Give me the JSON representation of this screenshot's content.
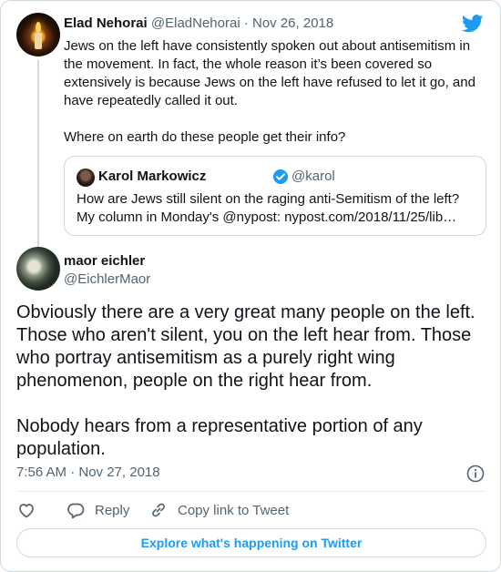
{
  "parent_tweet": {
    "author_name": "Elad Nehorai",
    "handle": "@EladNehorai",
    "separator": " · ",
    "date": "Nov 26, 2018",
    "text": "Jews on the left have consistently spoken out about antisemitism in the movement. In fact, the whole reason it’s been covered so extensively is because Jews on the left have refused to let it go, and have repeatedly called it out.\n\nWhere on earth do these people get their info?",
    "quoted": {
      "author_name": "Karol Markowicz",
      "handle": "@karol",
      "line1": "How are Jews still silent on the raging anti-Semitism of the left?",
      "line2": "My column in Monday's @nypost: nypost.com/2018/11/25/lib…"
    }
  },
  "main_tweet": {
    "author_name": "maor eichler",
    "handle": "@EichlerMaor",
    "text": "Obviously there are a very great many people on the left. Those who aren't silent, you on the left hear from. Those who portray antisemitism as a purely right wing phenomenon, people on the right hear from.\n\nNobody hears from a representative portion of any population.",
    "timestamp": "7:56 AM · Nov 27, 2018"
  },
  "actions": {
    "reply_label": "Reply",
    "copy_label": "Copy link to Tweet"
  },
  "explore_label": "Explore what's happening on Twitter",
  "colors": {
    "twitter_blue": "#1d9bf0",
    "text_primary": "#0f1419",
    "text_secondary": "#536471",
    "border": "#cfd9de"
  },
  "icons": [
    "twitter-bird-icon",
    "verified-badge-icon",
    "info-icon",
    "heart-icon",
    "reply-icon",
    "link-icon"
  ]
}
